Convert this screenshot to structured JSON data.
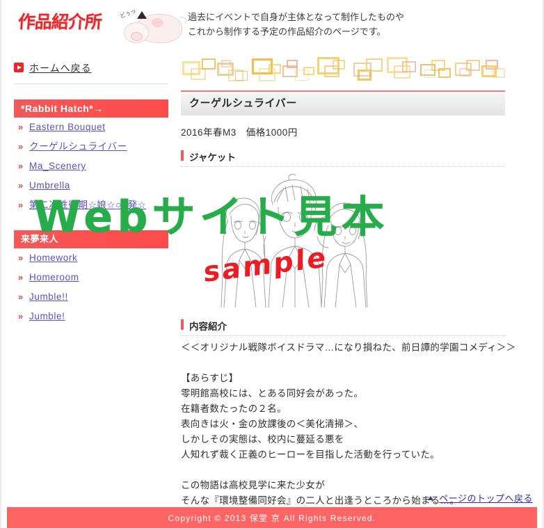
{
  "site": {
    "logo_text": "作品紹介所",
    "mascot_callout": "どぅっ",
    "description_lines": [
      "過去にイベントで自身が主体となって制作したものや",
      "これから制作する予定の作品紹介のページです。"
    ]
  },
  "sidebar": {
    "home_link": "ホームへ戻る",
    "sections": [
      {
        "title": "*Rabbit Hatch*→",
        "items": [
          "Eastern Bouquet",
          "クーゲルシュライバー",
          "Ma_Scenery",
          "Umbrella",
          "第二次性徴期☆娘☆○○発☆"
        ]
      },
      {
        "title": "来夢来人",
        "items": [
          "Homework",
          "Homeroom",
          "Jumble!!",
          "Jumble!"
        ]
      }
    ]
  },
  "main": {
    "work_title": "クーゲルシュライバー",
    "work_meta": "2016年春M3　価格1000円",
    "jacket_heading": "ジャケット",
    "content_heading": "内容紹介",
    "tagline": "＜＜オリジナル戦隊ボイスドラマ…になり損ねた、前日譚的学園コメディ＞＞",
    "synopsis_label": "【あらすじ】",
    "synopsis_lines": [
      "零明館高校には、とある同好会があった。",
      "在籍者数たったの２名。",
      "表向きは火・金の放課後の＜美化清掃＞、",
      "しかしその実態は、校内に蔓延る悪を",
      "人知れず裁く正義のヒーローを目指した活動を行っていた。"
    ],
    "closing_lines": [
      "この物語は高校見学に来た少女が",
      "そんな『環境整備同好会』の二人と出逢うところから始まる…。"
    ]
  },
  "back_to_top": "ページのトップへ戻る",
  "footer": {
    "copyright": "Copyright © 2013 保堂 京 All Rights Reserved."
  },
  "watermark": {
    "text": "Webサイト見本",
    "sample_text": "sample"
  },
  "colors": {
    "accent_red": "#f05a5a",
    "logo_red": "#e8262b",
    "footer_red": "#fd6464",
    "link_blue": "#5b4fc4",
    "watermark_green": "#27ab4b",
    "sample_red": "#ec1c24"
  }
}
